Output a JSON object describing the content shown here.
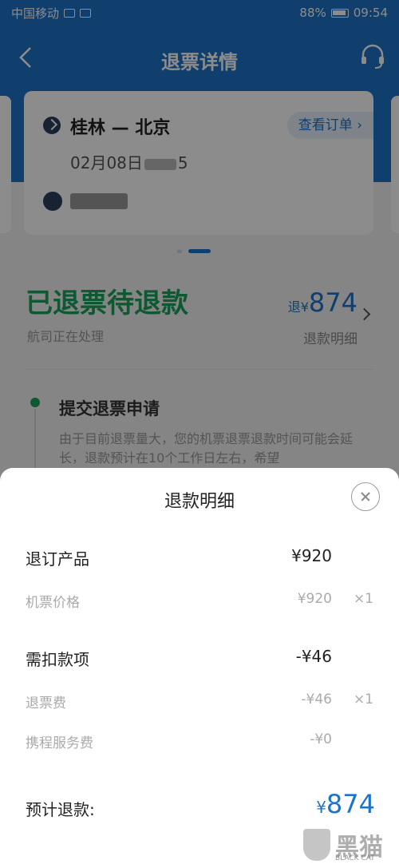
{
  "status_bar": {
    "carrier": "中国移动",
    "battery": "88%",
    "time": "09:54"
  },
  "header": {
    "title": "退票详情"
  },
  "flight_card": {
    "route": "桂林 — 北京",
    "view_order": "查看订单",
    "date": "02月08日",
    "time_suffix": "5"
  },
  "refund_status": {
    "title": "已退票待退款",
    "subtitle": "航司正在处理",
    "amount_prefix": "退¥",
    "amount": "874",
    "detail_link": "退款明细"
  },
  "timeline": {
    "step_title": "提交退票申请",
    "step_desc": "由于目前退票量大，您的机票退票退款时间可能会延长，退款预计在10个工作日左右，希望"
  },
  "sheet": {
    "title": "退款明细",
    "refund_product": {
      "label": "退订产品",
      "value": "¥920"
    },
    "ticket_price": {
      "label": "机票价格",
      "value": "¥920",
      "qty": "×1"
    },
    "deductions": {
      "label": "需扣款项",
      "value": "-¥46"
    },
    "refund_fee": {
      "label": "退票费",
      "value": "-¥46",
      "qty": "×1"
    },
    "service_fee": {
      "label": "携程服务费",
      "value": "-¥0"
    },
    "estimate": {
      "label": "预计退款:",
      "symbol": "¥",
      "amount": "874"
    }
  },
  "watermark": {
    "brand": "黑猫",
    "sub": "BLACK CAT"
  },
  "colors": {
    "primary": "#1e73c9",
    "success": "#1aa35a"
  }
}
